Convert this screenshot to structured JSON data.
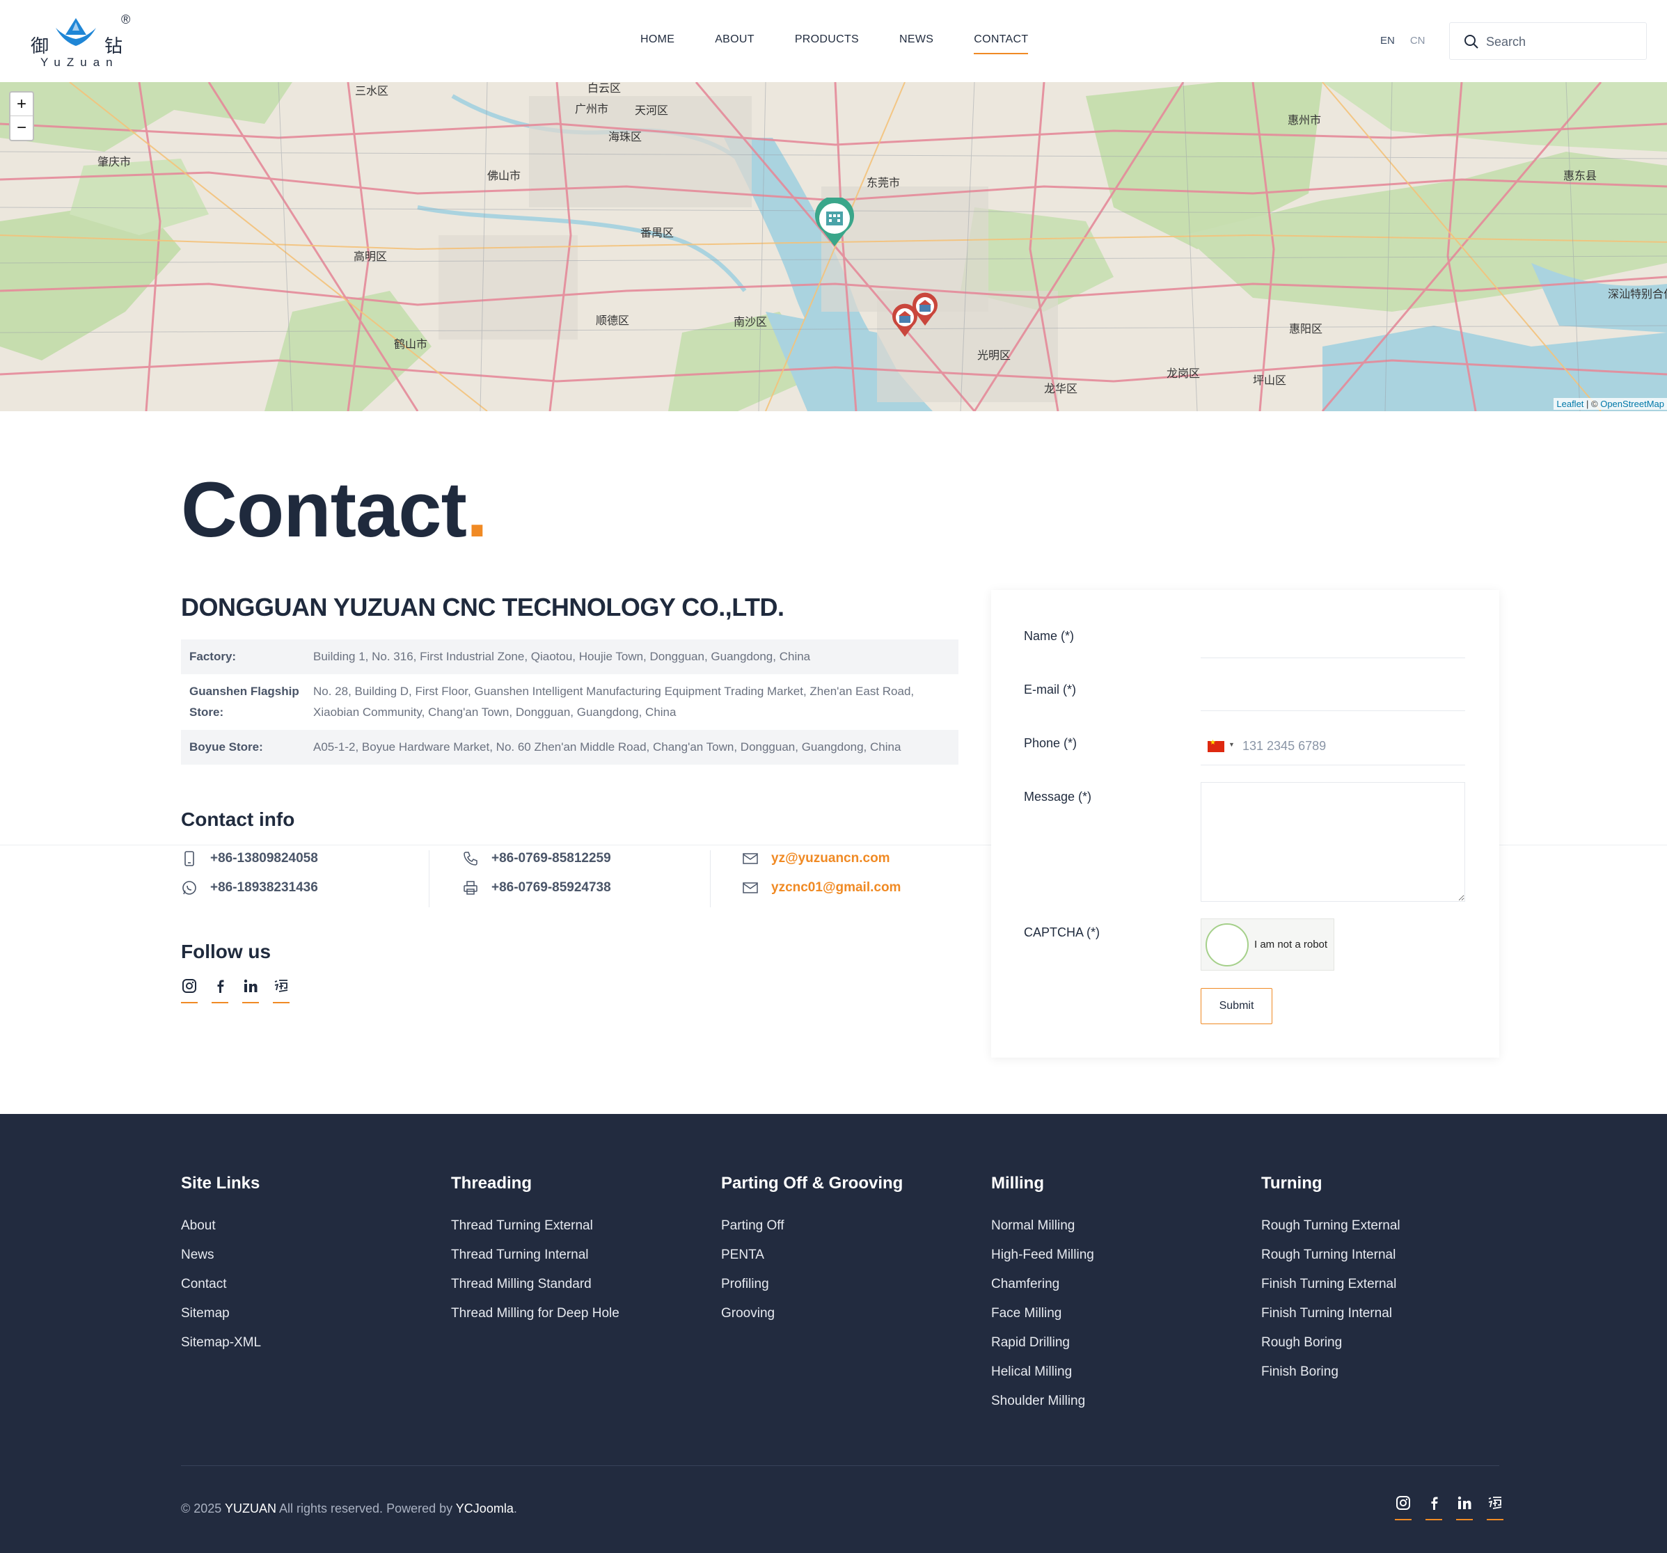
{
  "brand": {
    "logo_cn_left": "御",
    "logo_cn_right": "钻",
    "logo_reg": "®",
    "logo_en": "YuZuan"
  },
  "nav": {
    "items": [
      {
        "label": "HOME",
        "active": false
      },
      {
        "label": "ABOUT",
        "active": false
      },
      {
        "label": "PRODUCTS",
        "active": false
      },
      {
        "label": "NEWS",
        "active": false
      },
      {
        "label": "CONTACT",
        "active": true
      }
    ],
    "accent_color": "#f08a24"
  },
  "lang": {
    "en": "EN",
    "cn": "CN"
  },
  "search": {
    "placeholder": "Search",
    "icon": "search-icon"
  },
  "map": {
    "zoom_in": "+",
    "zoom_out": "−",
    "attribution_leaflet": "Leaflet",
    "attribution_sep": " | © ",
    "attribution_osm": "OpenStreetMap",
    "places": [
      "肇庆市",
      "佛山市",
      "广州市",
      "东莞市",
      "惠州市",
      "惠东县",
      "高明区",
      "鹤山市",
      "顺德区",
      "南沙区",
      "番禺区",
      "光明区",
      "龙华区",
      "龙岗区",
      "坪山区",
      "惠阳区",
      "深汕特别合作区",
      "三水区",
      "白云区",
      "天河区",
      "海珠区"
    ]
  },
  "contact": {
    "title": "Contact",
    "title_dot": ".",
    "company": "DONGGUAN YUZUAN CNC TECHNOLOGY CO.,LTD.",
    "addresses": [
      {
        "label": "Factory:",
        "value": "Building 1, No. 316, First Industrial Zone, Qiaotou, Houjie Town, Dongguan, Guangdong, China"
      },
      {
        "label": "Guanshen Flagship Store:",
        "value": "No. 28, Building D, First Floor, Guanshen Intelligent Manufacturing Equipment Trading Market, Zhen'an East Road, Xiaobian Community, Chang'an Town, Dongguan, Guangdong, China"
      },
      {
        "label": "Boyue Store:",
        "value": "A05-1-2, Boyue Hardware Market, No. 60 Zhen'an Middle Road, Chang'an Town, Dongguan, Guangdong, China"
      }
    ],
    "info_title": "Contact info",
    "mobile": "+86-13809824058",
    "whatsapp": "+86-18938231436",
    "tel": "+86-0769-85812259",
    "fax": "+86-0769-85924738",
    "email1": "yz@yuzuancn.com",
    "email2": "yzcnc01@gmail.com",
    "follow_title": "Follow us",
    "social": [
      "instagram-icon",
      "facebook-icon",
      "linkedin-icon",
      "taobao-icon"
    ]
  },
  "form": {
    "name_label": "Name (*)",
    "email_label": "E-mail (*)",
    "phone_label": "Phone (*)",
    "phone_placeholder": "131 2345 6789",
    "message_label": "Message (*)",
    "captcha_label": "CAPTCHA (*)",
    "captcha_text": "I am not a robot",
    "submit": "Submit"
  },
  "footer": {
    "columns": [
      {
        "title": "Site Links",
        "links": [
          "About",
          "News",
          "Contact",
          "Sitemap",
          "Sitemap-XML"
        ]
      },
      {
        "title": "Threading",
        "links": [
          "Thread Turning External",
          "Thread Turning Internal",
          "Thread Milling Standard",
          "Thread Milling for Deep Hole"
        ]
      },
      {
        "title": "Parting Off & Grooving",
        "links": [
          "Parting Off",
          "PENTA",
          "Profiling",
          "Grooving"
        ]
      },
      {
        "title": "Milling",
        "links": [
          "Normal Milling",
          "High-Feed Milling",
          "Chamfering",
          "Face Milling",
          "Rapid Drilling",
          "Helical Milling",
          "Shoulder Milling"
        ]
      },
      {
        "title": "Turning",
        "links": [
          "Rough Turning External",
          "Rough Turning Internal",
          "Finish Turning External",
          "Finish Turning Internal",
          "Rough Boring",
          "Finish Boring"
        ]
      }
    ],
    "copy_prefix": "© 2025 ",
    "copy_brand": "YUZUAN",
    "copy_mid": " All rights reserved. Powered by ",
    "copy_powered": "YCJoomla",
    "copy_suffix": ".",
    "background": "#222b3f"
  }
}
